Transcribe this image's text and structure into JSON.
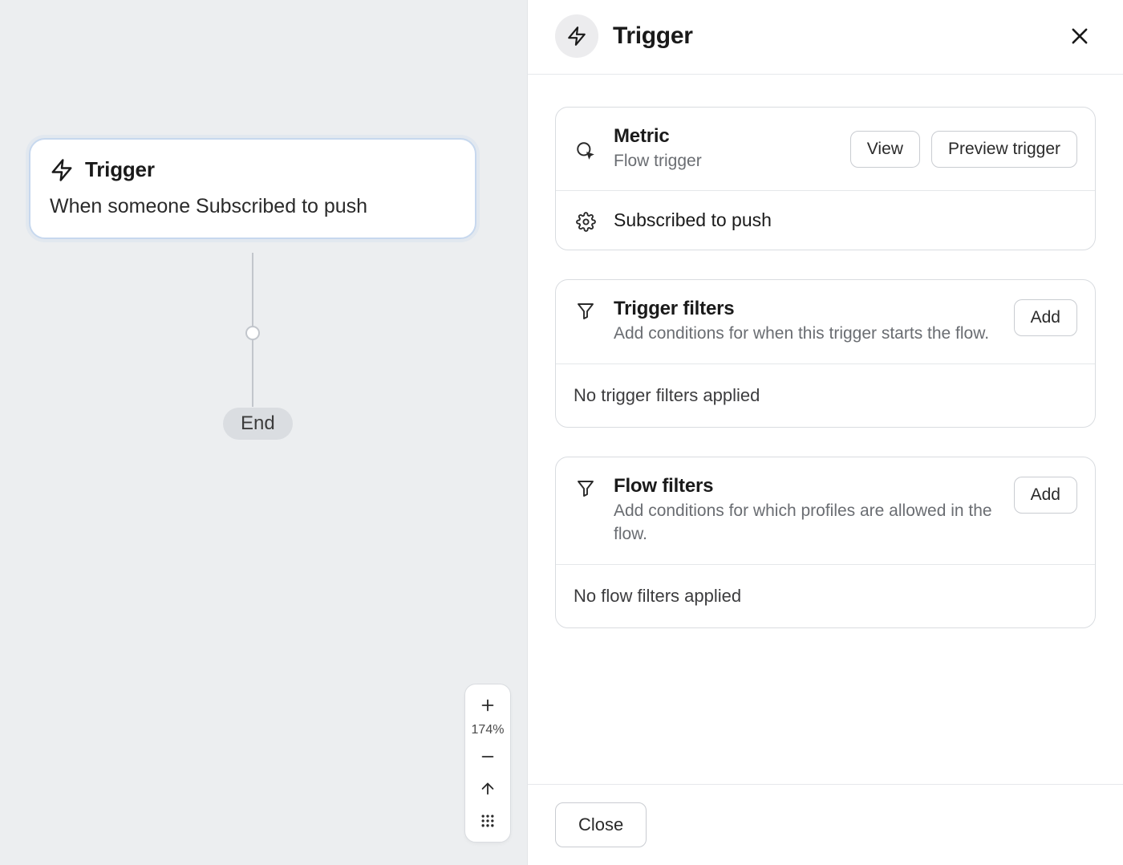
{
  "canvas": {
    "trigger_node": {
      "title": "Trigger",
      "description": "When someone Subscribed to push"
    },
    "end_label": "End",
    "zoom_percent": "174%"
  },
  "panel": {
    "title": "Trigger",
    "metric": {
      "title": "Metric",
      "subtitle": "Flow trigger",
      "view_btn": "View",
      "preview_btn": "Preview trigger",
      "selected": "Subscribed to push"
    },
    "trigger_filters": {
      "title": "Trigger filters",
      "subtitle": "Add conditions for when this trigger starts the flow.",
      "add_btn": "Add",
      "empty": "No trigger filters applied"
    },
    "flow_filters": {
      "title": "Flow filters",
      "subtitle": "Add conditions for which profiles are allowed in the flow.",
      "add_btn": "Add",
      "empty": "No flow filters applied"
    },
    "footer": {
      "close_btn": "Close"
    }
  }
}
